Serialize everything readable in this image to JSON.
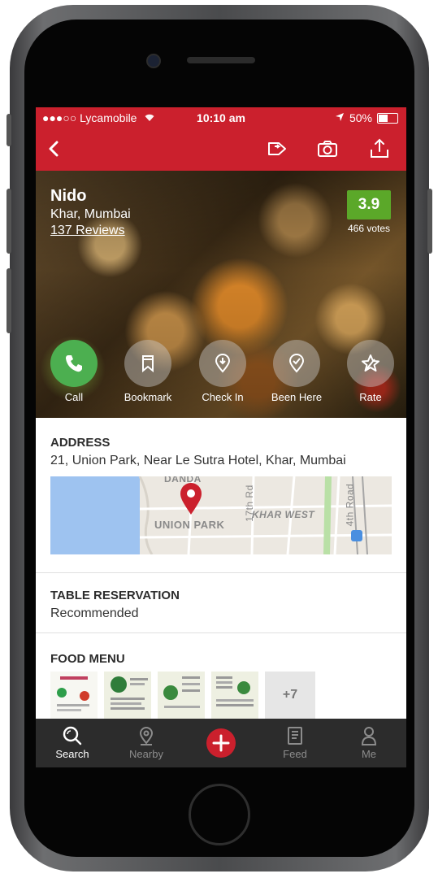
{
  "status_bar": {
    "carrier": "●●●○○ Lycamobile",
    "time": "10:10 am",
    "battery": "50%"
  },
  "restaurant": {
    "name": "Nido",
    "location": "Khar, Mumbai",
    "reviews": "137 Reviews",
    "rating": "3.9",
    "votes": "466 votes"
  },
  "actions": [
    {
      "label": "Call",
      "icon": "phone-icon"
    },
    {
      "label": "Bookmark",
      "icon": "bookmark-icon"
    },
    {
      "label": "Check In",
      "icon": "check-in-icon"
    },
    {
      "label": "Been Here",
      "icon": "been-here-icon"
    },
    {
      "label": "Rate",
      "icon": "star-icon"
    }
  ],
  "address": {
    "title": "ADDRESS",
    "text": "21, Union Park, Near Le Sutra Hotel, Khar, Mumbai",
    "map_labels": [
      "DANDA",
      "UNION PARK",
      "17th Rd",
      "KHAR WEST",
      "4th Road"
    ]
  },
  "reservation": {
    "title": "TABLE RESERVATION",
    "value": "Recommended"
  },
  "menu": {
    "title": "FOOD MENU",
    "more": "+7"
  },
  "tabs": [
    {
      "label": "Search",
      "icon": "search-icon"
    },
    {
      "label": "Nearby",
      "icon": "location-pin-icon"
    },
    {
      "label": "Feed",
      "icon": "feed-icon"
    },
    {
      "label": "Me",
      "icon": "user-icon"
    }
  ],
  "colors": {
    "brand_red": "#cb202d",
    "rating_green": "#5ba829",
    "call_green": "#4caf50"
  }
}
